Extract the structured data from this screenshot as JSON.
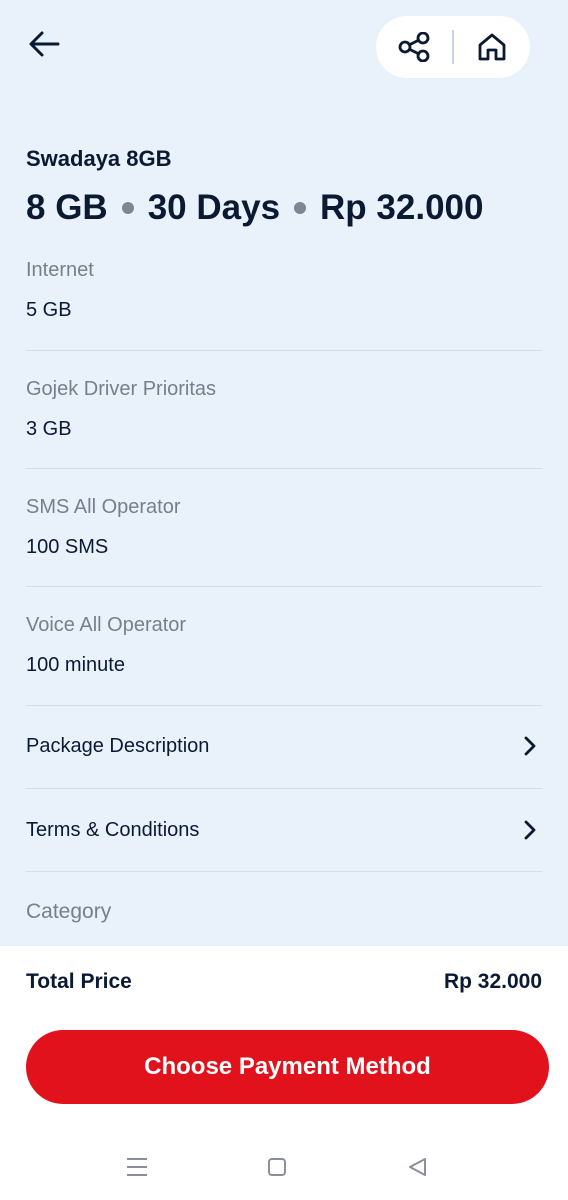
{
  "package": {
    "name": "Swadaya 8GB",
    "quota": "8 GB",
    "duration": "30 Days",
    "price": "Rp 32.000"
  },
  "details": [
    {
      "label": "Internet",
      "value": "5 GB"
    },
    {
      "label": "Gojek Driver Prioritas",
      "value": "3 GB"
    },
    {
      "label": "SMS All Operator",
      "value": "100 SMS"
    },
    {
      "label": "Voice All Operator",
      "value": "100 minute"
    }
  ],
  "links": {
    "package_description": "Package Description",
    "terms": "Terms & Conditions"
  },
  "category_label": "Category",
  "footer": {
    "total_label": "Total Price",
    "total_value": "Rp 32.000",
    "pay_button": "Choose Payment Method"
  },
  "icons": {
    "back": "arrow-left-icon",
    "share": "share-icon",
    "home": "home-icon",
    "chevron": "chevron-right-icon",
    "nav_menu": "menu-icon",
    "nav_home": "square-icon",
    "nav_back": "triangle-back-icon"
  },
  "colors": {
    "background": "#e9f1fb",
    "primary_text": "#0b1a33",
    "muted_text": "#76808d",
    "accent": "#e2121c"
  }
}
